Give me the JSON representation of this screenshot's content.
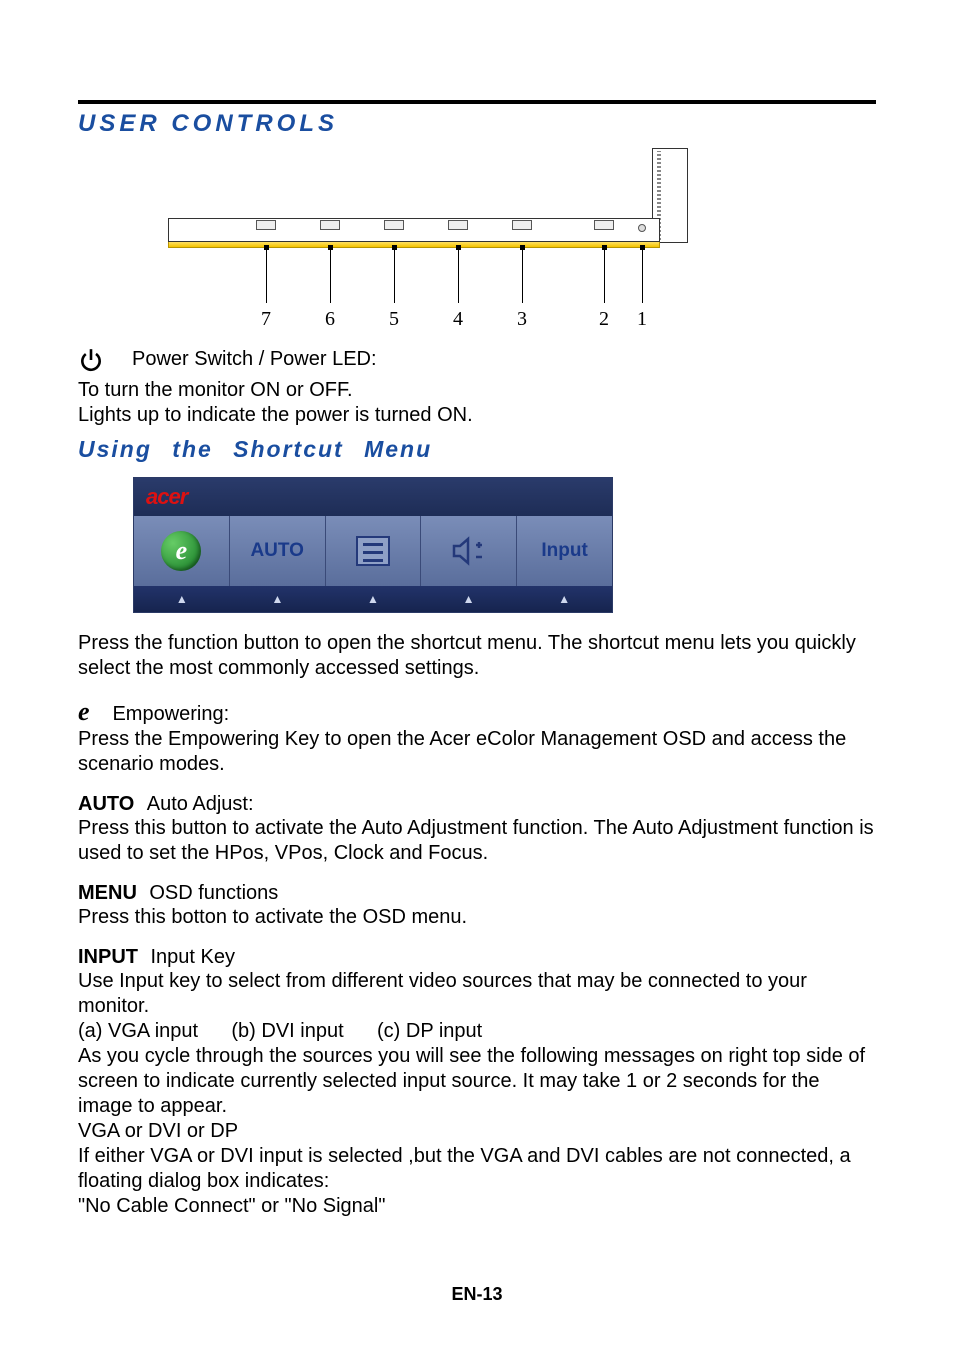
{
  "section_title": "USER CONTROLS",
  "diagram": {
    "callouts": [
      "7",
      "6",
      "5",
      "4",
      "3",
      "2",
      "1"
    ]
  },
  "power": {
    "heading": "Power Switch / Power LED:",
    "line1": "To turn the monitor ON or OFF.",
    "line2": "Lights up to indicate the power is turned ON."
  },
  "subsection_title": "Using  the Shortcut Menu",
  "osd": {
    "brand": "acer",
    "cells": {
      "auto": "AUTO",
      "input": "Input"
    }
  },
  "intro": "Press the function button to open the shortcut menu. The shortcut menu lets you quickly select the most commonly accessed settings.",
  "empowering": {
    "title": "Empowering:",
    "text": "Press the Empowering Key to open the Acer eColor Management OSD and access the scenario modes."
  },
  "auto": {
    "label": "AUTO",
    "title": "Auto Adjust:",
    "text": "Press this button to activate the Auto Adjustment function. The Auto Adjustment function is used to set the HPos, VPos, Clock and Focus."
  },
  "menu": {
    "label": "MENU",
    "title": "OSD functions",
    "text": "Press this botton to activate the OSD menu."
  },
  "input": {
    "label": "INPUT",
    "title": "Input Key",
    "text1": "Use Input key to select from different video sources that may be connected to your monitor.",
    "options": "(a) VGA input      (b) DVI input      (c) DP input",
    "text2": "As you cycle through the sources you will see the following messages on right top side of screen to indicate currently selected input source. It may take 1 or 2 seconds for the image to appear.",
    "modes": "VGA  or  DVI  or  DP",
    "text3": "If either VGA or DVI input is selected ,but the VGA and DVI cables are not connected, a floating dialog box indicates:",
    "text4": "\"No Cable Connect\" or \"No Signal\""
  },
  "page_number": "EN-13"
}
